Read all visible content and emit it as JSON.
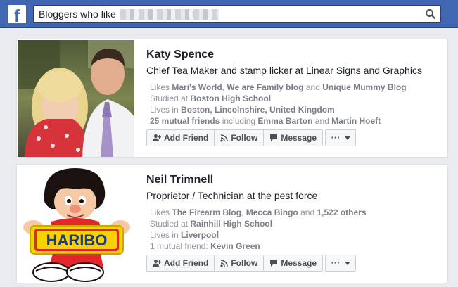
{
  "topbar": {
    "logo_letter": "f",
    "search": {
      "value": "Bloggers who like"
    }
  },
  "results": [
    {
      "name": "Katy Spence",
      "tagline": "Chief Tea Maker and stamp licker at Linear Signs and Graphics",
      "likes_prefix": "Likes",
      "likes": [
        "Mari's World",
        "We are Family blog",
        "Unique Mummy Blog"
      ],
      "likes_sep": ",",
      "likes_and": "and",
      "studied_prefix": "Studied at",
      "studied": "Boston High School",
      "lives_prefix": "Lives in",
      "lives": "Boston, Lincolnshire, United Kingdom",
      "mutual": "25 mutual friends",
      "mutual_including": "including",
      "mutual_names": [
        "Emma Barton",
        "Martin Hoeft"
      ],
      "buttons": {
        "add_friend": "Add Friend",
        "follow": "Follow",
        "message": "Message"
      },
      "more": "···"
    },
    {
      "name": "Neil Trimnell",
      "tagline": "Proprietor / Technician at the pest force",
      "likes_prefix": "Likes",
      "likes": [
        "The Firearm Blog",
        "Mecca Bingo",
        "1,522 others"
      ],
      "likes_sep": ",",
      "likes_and": "and",
      "studied_prefix": "Studied at",
      "studied": "Rainhill High School",
      "lives_prefix": "Lives in",
      "lives": "Liverpool",
      "mutual": "1 mutual friend:",
      "mutual_names": [
        "Kevin Green"
      ],
      "buttons": {
        "add_friend": "Add Friend",
        "follow": "Follow",
        "message": "Message"
      },
      "more": "···",
      "photo_logo_text": "HARIBO"
    }
  ],
  "colors": {
    "topbar": "#4267b2",
    "page_bg": "#e9ebee",
    "haribo_red": "#e3262b",
    "haribo_yellow": "#f6d300"
  }
}
